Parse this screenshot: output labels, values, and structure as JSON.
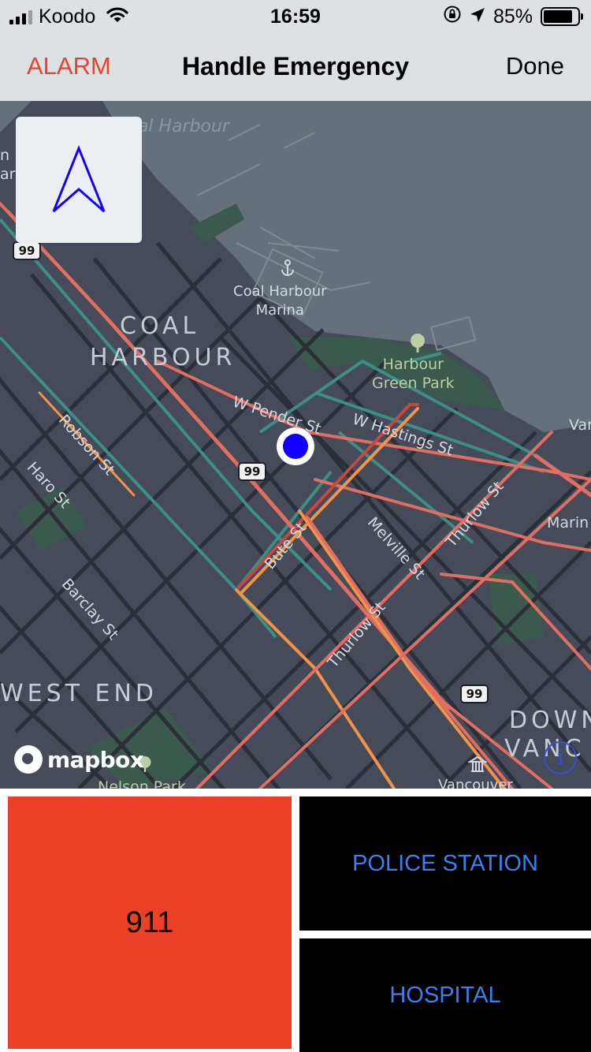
{
  "status_bar": {
    "carrier": "Koodo",
    "time": "16:59",
    "battery_percent": "85%",
    "battery_level": 0.85,
    "icons": [
      "signal-icon",
      "wifi-icon",
      "orientation-lock-icon",
      "location-arrow-icon",
      "battery-icon"
    ]
  },
  "nav": {
    "left_label": "ALARM",
    "title": "Handle Emergency",
    "right_label": "Done",
    "left_color": "#e8432d"
  },
  "map": {
    "labels": {
      "water": "Coal Harbour",
      "marina": "Coal Harbour\nMarina",
      "district_coal": "COAL",
      "district_harbour": "HARBOUR",
      "park": "Harbour\nGreen Park",
      "w_pender": "W Pender St",
      "w_hastings": "W Hastings St",
      "robson": "Robson St",
      "haro": "Haro St",
      "bute": "Bute St",
      "melville": "Melville St",
      "thurlow_upper": "Thurlow St",
      "thurlow_lower": "Thurlow St",
      "barclay": "Barclay St",
      "west_end": "WEST END",
      "downtown_1": "DOWN",
      "downtown_2": "VANC",
      "marine": "Marin",
      "van": "Van",
      "nelson_park": "Nelson Park",
      "vancouver_poi": "Vancouver",
      "left_edge_1": "n",
      "left_edge_2": "ark"
    },
    "highway_shields": [
      "99",
      "99",
      "99"
    ],
    "attribution": "mapbox",
    "info_symbol": "i",
    "compass_icon": "navigation-arrow-icon",
    "user_location_color": "#1200ff"
  },
  "actions": {
    "emergency_label": "911",
    "police_label": "POLICE STATION",
    "hospital_label": "HOSPITAL",
    "emergency_color": "#eb4128",
    "secondary_text_color": "#3a80f0"
  }
}
